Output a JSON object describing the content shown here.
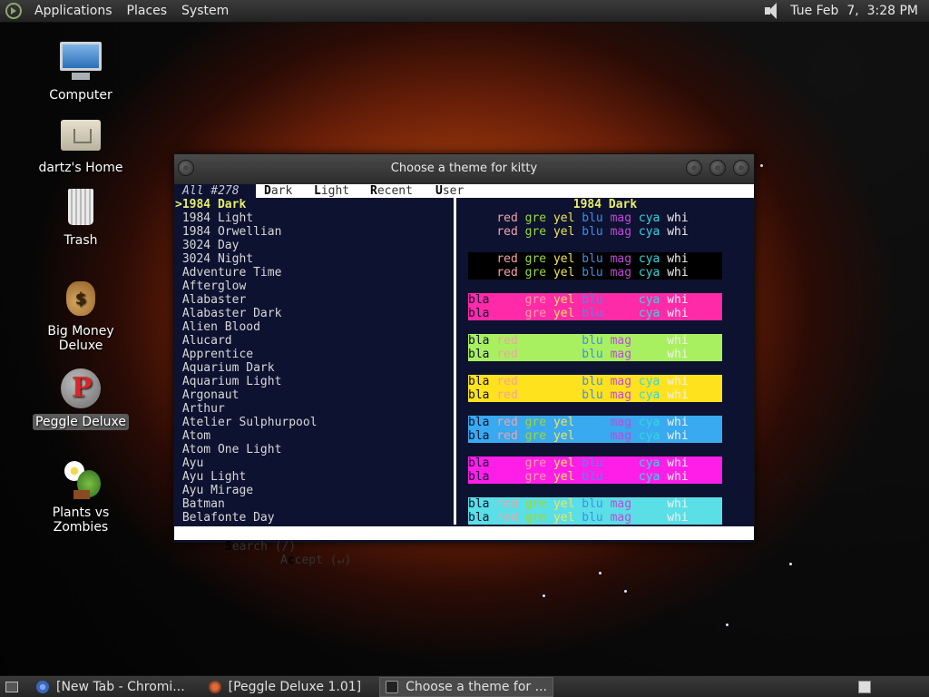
{
  "top_panel": {
    "menus": [
      "Applications",
      "Places",
      "System"
    ],
    "clock": "Tue Feb  7,  3:28 PM"
  },
  "desktop": {
    "icons": [
      {
        "label": "Computer",
        "icon": "computer-icon"
      },
      {
        "label": "dartz's Home",
        "icon": "home-folder-icon"
      },
      {
        "label": "Trash",
        "icon": "trash-icon"
      },
      {
        "label": "Big Money Deluxe",
        "icon": "money-bag-icon"
      },
      {
        "label": "Peggle Deluxe",
        "icon": "peggle-icon",
        "selected": true
      },
      {
        "label": "Plants vs Zombies",
        "icon": "plants-vs-zombies-icon"
      }
    ]
  },
  "window": {
    "title": "Choose a theme for kitty",
    "tabbar": {
      "all": "All #278",
      "tabs": [
        {
          "key": "D",
          "rest": "ark"
        },
        {
          "key": "L",
          "rest": "ight"
        },
        {
          "key": "R",
          "rest": "ecent"
        },
        {
          "key": "U",
          "rest": "ser"
        }
      ]
    },
    "cursor": ">",
    "themes": [
      "1984 Dark",
      "1984 Light",
      "1984 Orwellian",
      "3024 Day",
      "3024 Night",
      "Adventure Time",
      "Afterglow",
      "Alabaster",
      "Alabaster Dark",
      "Alien Blood",
      "Alucard",
      "Apprentice",
      "Aquarium Dark",
      "Aquarium Light",
      "Argonaut",
      "Arthur",
      "Atelier Sulphurpool",
      "Atom",
      "Atom One Light",
      "Ayu",
      "Ayu Light",
      "Ayu Mirage",
      "Batman",
      "Belafonte Day"
    ],
    "preview": {
      "title": "1984 Dark",
      "color_names": [
        "bla",
        "red",
        "gre",
        "yel",
        "blu",
        "mag",
        "cya",
        "whi"
      ],
      "groups": [
        {
          "bg": "#0d1230",
          "fg": [
            "#0d1230",
            "#f6a0a8",
            "#9ad83c",
            "#f0e65a",
            "#3a8ff0",
            "#c04ad8",
            "#30d8e0",
            "#f0f0f0"
          ]
        },
        {
          "bg": "#000000",
          "fg": [
            "#000000",
            "#f6a0a8",
            "#9ad83c",
            "#f0e65a",
            "#3a8ff0",
            "#c04ad8",
            "#30d8e0",
            "#f0f0f0"
          ]
        },
        {
          "bg": "#ff2aa8",
          "fg": [
            "#0d1230",
            "#ff2aa8",
            "#f6a0a8",
            "#f0e65a",
            "#3a8ff0",
            "#ff2aa8",
            "#30d8e0",
            "#f0f0f0"
          ]
        },
        {
          "bg": "#a8f060",
          "fg": [
            "#0d1230",
            "#f6a0a8",
            "#a8f060",
            "#a8f060",
            "#3a8ff0",
            "#c04ad8",
            "#a8f060",
            "#f0f0f0"
          ]
        },
        {
          "bg": "#ffe21e",
          "fg": [
            "#0d1230",
            "#f6a0a8",
            "#ffe21e",
            "#ffe21e",
            "#3a8ff0",
            "#c04ad8",
            "#30d8e0",
            "#f0f0f0"
          ]
        },
        {
          "bg": "#39a9f0",
          "fg": [
            "#0d1230",
            "#f6a0a8",
            "#9ad83c",
            "#f0e65a",
            "#39a9f0",
            "#c04ad8",
            "#30d8e0",
            "#f0f0f0"
          ]
        },
        {
          "bg": "#ff1ee8",
          "fg": [
            "#0d1230",
            "#ff1ee8",
            "#f6a0a8",
            "#f0e65a",
            "#3a8ff0",
            "#ff1ee8",
            "#30d8e0",
            "#f0f0f0"
          ]
        },
        {
          "bg": "#5adfe6",
          "fg": [
            "#0d1230",
            "#f6a0a8",
            "#9ad83c",
            "#f0e65a",
            "#3a8ff0",
            "#c04ad8",
            "#5adfe6",
            "#f0f0f0"
          ]
        }
      ]
    },
    "footer": {
      "search_key": "S",
      "search_rest": "earch (/)",
      "accept_pre": "A",
      "accept_key": "c",
      "accept_rest": "cept (↵)"
    }
  },
  "taskbar": {
    "tasks": [
      {
        "label": "[New Tab - Chromi...",
        "icon": "chromium-icon",
        "active": false
      },
      {
        "label": "[Peggle Deluxe 1.01]",
        "icon": "peggle-icon",
        "active": false
      },
      {
        "label": "Choose a theme for ...",
        "icon": "terminal-icon",
        "active": true
      }
    ]
  }
}
